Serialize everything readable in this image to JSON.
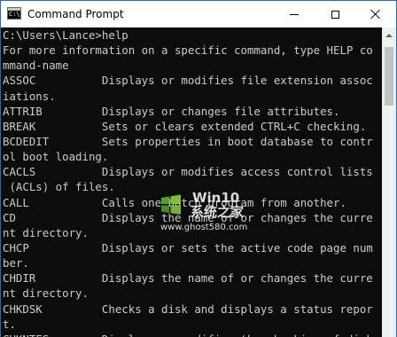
{
  "window": {
    "title": "Command Prompt",
    "icon": "cmd-icon",
    "icon_glyph": "C:\\"
  },
  "title_buttons": {
    "minimize": "minimize-icon",
    "maximize": "maximize-icon",
    "close": "close-icon"
  },
  "console": {
    "lines": [
      "C:\\Users\\Lance>help",
      "For more information on a specific command, type HELP co",
      "mmand-name",
      "ASSOC          Displays or modifies file extension assoc",
      "iations.",
      "ATTRIB         Displays or changes file attributes.",
      "BREAK          Sets or clears extended CTRL+C checking.",
      "BCDEDIT        Sets properties in boot database to contr",
      "ol boot loading.",
      "CACLS          Displays or modifies access control lists",
      " (ACLs) of files.",
      "CALL           Calls one batch program from another.",
      "CD             Displays the name of or changes the curre",
      "nt directory.",
      "CHCP           Displays or sets the active code page num",
      "ber.",
      "CHDIR          Displays the name of or changes the curre",
      "nt directory.",
      "CHKDSK         Checks a disk and displays a status repor",
      "t.",
      "CHKNTFS        Displays or modifies the checking of disk"
    ]
  },
  "watermark": {
    "title": "Win10",
    "subtitle": "系统之家",
    "url": "www.ghost580.com"
  },
  "colors": {
    "console_bg": "#0c0c0c",
    "console_text": "#cccccc",
    "titlebar_bg": "#ffffff",
    "border_accent": "#1b6ac9"
  }
}
